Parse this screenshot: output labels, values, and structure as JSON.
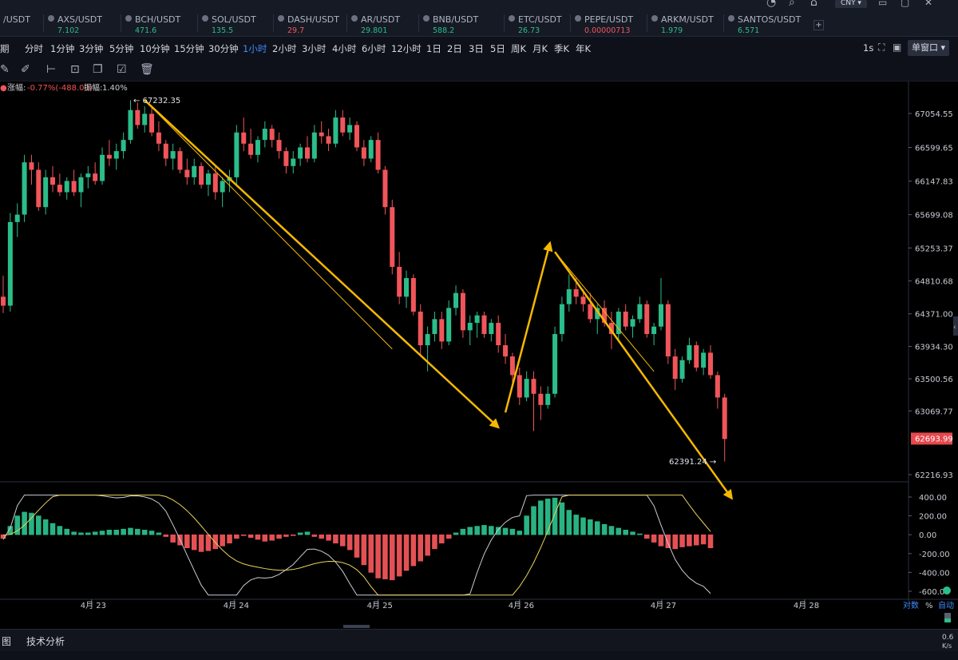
{
  "tickers": [
    {
      "symbol": "/USDT",
      "price": "",
      "dir": "up"
    },
    {
      "symbol": "AXS/USDT",
      "price": "7.102",
      "dir": "up"
    },
    {
      "symbol": "BCH/USDT",
      "price": "471.6",
      "dir": "up"
    },
    {
      "symbol": "SOL/USDT",
      "price": "135.5",
      "dir": "up"
    },
    {
      "symbol": "DASH/USDT",
      "price": "29.7",
      "dir": "dn"
    },
    {
      "symbol": "AR/USDT",
      "price": "29.801",
      "dir": "up"
    },
    {
      "symbol": "BNB/USDT",
      "price": "588.2",
      "dir": "up"
    },
    {
      "symbol": "ETC/USDT",
      "price": "26.73",
      "dir": "up"
    },
    {
      "symbol": "PEPE/USDT",
      "price": "0.00000713",
      "dir": "dn"
    },
    {
      "symbol": "ARKM/USDT",
      "price": "1.979",
      "dir": "up"
    },
    {
      "symbol": "SANTOS/USDT",
      "price": "6.571",
      "dir": "up"
    }
  ],
  "currency": "CNY",
  "add_symbol": "+",
  "intervals": [
    "期",
    "分时",
    "1分钟",
    "3分钟",
    "5分钟",
    "10分钟",
    "15分钟",
    "30分钟",
    "1小时",
    "2小时",
    "3小时",
    "4小时",
    "6小时",
    "12小时",
    "1日",
    "2日",
    "3日",
    "5日",
    "周K",
    "月K",
    "季K",
    "年K"
  ],
  "active_interval": "1小时",
  "refresh_rate": "1s",
  "window_mode": "单窗口",
  "change_label": "涨幅:",
  "change_value": "-0.77%(-488.00)",
  "amplitude_label": "振幅:",
  "amplitude_value": "1.40%",
  "high_label": "67232.35",
  "low_label": "62391.24",
  "last_price": "62693.99",
  "scale_log": "对数",
  "scale_pct": "%",
  "scale_auto": "自动",
  "speed_value": "0.6",
  "speed_unit": "K/s",
  "bottom_tabs": [
    "图",
    "技术分析"
  ],
  "chart_data": {
    "type": "candlestick",
    "price_axis_ticks": [
      67054.55,
      66599.65,
      66147.83,
      65699.08,
      65253.37,
      64810.68,
      64371.0,
      63934.3,
      63500.56,
      63069.77,
      62216.93
    ],
    "price_axis_labels": [
      "67054.55",
      "66599.65",
      "66147.83",
      "65699.08",
      "65253.37",
      "64810.68",
      "64371.00",
      "63934.30",
      "63500.56",
      "63069.77",
      "62216.93"
    ],
    "macd_ticks": [
      400,
      200,
      0,
      -200,
      -400,
      -600
    ],
    "macd_labels": [
      "400.00",
      "200.00",
      "0.00",
      "-200.00",
      "-400.00",
      "-600.00"
    ],
    "date_labels": [
      "4月 23",
      "4月 24",
      "4月 25",
      "4月 26",
      "4月 27",
      "4月 28"
    ],
    "colors": {
      "up": "#2bbd8a",
      "down": "#f0555a",
      "arrow": "#f5b800",
      "dif": "#c8ccd4",
      "dea": "#e8d35a"
    },
    "candles": [
      [
        64600,
        64880,
        64380,
        64480
      ],
      [
        64480,
        65720,
        64400,
        65600
      ],
      [
        65600,
        65850,
        65400,
        65700
      ],
      [
        65700,
        66500,
        65600,
        66400
      ],
      [
        66400,
        66500,
        66100,
        66300
      ],
      [
        66300,
        66400,
        65750,
        65800
      ],
      [
        65800,
        66300,
        65700,
        66200
      ],
      [
        66200,
        66350,
        66000,
        66100
      ],
      [
        66100,
        66250,
        65950,
        66000
      ],
      [
        66000,
        66200,
        65900,
        66150
      ],
      [
        66150,
        66300,
        65950,
        66000
      ],
      [
        66000,
        66250,
        65800,
        66200
      ],
      [
        66200,
        66350,
        66050,
        66250
      ],
      [
        66250,
        66400,
        66100,
        66150
      ],
      [
        66150,
        66600,
        66100,
        66500
      ],
      [
        66500,
        66700,
        66350,
        66450
      ],
      [
        66450,
        66650,
        66300,
        66550
      ],
      [
        66550,
        66800,
        66450,
        66700
      ],
      [
        66700,
        67232.35,
        66650,
        67100
      ],
      [
        67100,
        67200,
        66850,
        66900
      ],
      [
        66900,
        67150,
        66800,
        67050
      ],
      [
        67050,
        67150,
        66750,
        66800
      ],
      [
        66800,
        66950,
        66550,
        66650
      ],
      [
        66650,
        66700,
        66350,
        66450
      ],
      [
        66450,
        66650,
        66300,
        66550
      ],
      [
        66550,
        66600,
        66250,
        66300
      ],
      [
        66300,
        66450,
        66100,
        66200
      ],
      [
        66200,
        66450,
        66100,
        66350
      ],
      [
        66350,
        66400,
        66050,
        66100
      ],
      [
        66100,
        66300,
        65950,
        66250
      ],
      [
        66250,
        66350,
        65900,
        66000
      ],
      [
        66000,
        66200,
        65800,
        66150
      ],
      [
        66150,
        66300,
        66000,
        66200
      ],
      [
        66200,
        66900,
        66100,
        66800
      ],
      [
        66800,
        67000,
        66550,
        66650
      ],
      [
        66650,
        66850,
        66450,
        66500
      ],
      [
        66500,
        66750,
        66400,
        66700
      ],
      [
        66700,
        66950,
        66600,
        66850
      ],
      [
        66850,
        66900,
        66600,
        66700
      ],
      [
        66700,
        66800,
        66450,
        66550
      ],
      [
        66550,
        66600,
        66250,
        66350
      ],
      [
        66350,
        66550,
        66250,
        66450
      ],
      [
        66450,
        66650,
        66350,
        66600
      ],
      [
        66600,
        66750,
        66400,
        66450
      ],
      [
        66450,
        66900,
        66400,
        66800
      ],
      [
        66800,
        66950,
        66650,
        66750
      ],
      [
        66750,
        66850,
        66550,
        66650
      ],
      [
        66650,
        67100,
        66600,
        67000
      ],
      [
        67000,
        67100,
        66750,
        66800
      ],
      [
        66800,
        67000,
        66700,
        66900
      ],
      [
        66900,
        66950,
        66550,
        66600
      ],
      [
        66600,
        66700,
        66350,
        66450
      ],
      [
        66450,
        66750,
        66400,
        66700
      ],
      [
        66700,
        66800,
        66250,
        66300
      ],
      [
        66300,
        66350,
        65700,
        65800
      ],
      [
        65800,
        65900,
        64900,
        65000
      ],
      [
        65000,
        65200,
        64500,
        64600
      ],
      [
        64600,
        64950,
        64450,
        64850
      ],
      [
        64850,
        64900,
        64350,
        64400
      ],
      [
        64400,
        64500,
        63800,
        63950
      ],
      [
        63950,
        64200,
        63600,
        64100
      ],
      [
        64100,
        64400,
        64000,
        64300
      ],
      [
        64300,
        64400,
        63900,
        64000
      ],
      [
        64000,
        64550,
        63950,
        64450
      ],
      [
        64450,
        64750,
        64350,
        64650
      ],
      [
        64650,
        64700,
        64050,
        64150
      ],
      [
        64150,
        64350,
        63950,
        64250
      ],
      [
        64250,
        64400,
        64050,
        64350
      ],
      [
        64350,
        64400,
        64050,
        64100
      ],
      [
        64100,
        64300,
        64000,
        64250
      ],
      [
        64250,
        64350,
        63850,
        63950
      ],
      [
        63950,
        64100,
        63700,
        63800
      ],
      [
        63800,
        63850,
        63450,
        63550
      ],
      [
        63550,
        63650,
        63150,
        63250
      ],
      [
        63250,
        63600,
        63200,
        63500
      ],
      [
        63500,
        63600,
        62800,
        63300
      ],
      [
        63300,
        63400,
        62950,
        63150
      ],
      [
        63150,
        63400,
        63100,
        63300
      ],
      [
        63300,
        64200,
        63250,
        64100
      ],
      [
        64100,
        64600,
        64000,
        64500
      ],
      [
        64500,
        64900,
        64400,
        64700
      ],
      [
        64700,
        64850,
        64500,
        64600
      ],
      [
        64600,
        64700,
        64400,
        64500
      ],
      [
        64500,
        64650,
        64250,
        64300
      ],
      [
        64300,
        64500,
        64100,
        64450
      ],
      [
        64450,
        64550,
        64200,
        64250
      ],
      [
        64250,
        64400,
        63900,
        64100
      ],
      [
        64100,
        64450,
        64000,
        64400
      ],
      [
        64400,
        64500,
        64150,
        64200
      ],
      [
        64200,
        64350,
        64050,
        64300
      ],
      [
        64300,
        64600,
        64250,
        64500
      ],
      [
        64500,
        64550,
        64050,
        64100
      ],
      [
        64100,
        64250,
        63950,
        64200
      ],
      [
        64200,
        64850,
        64150,
        64500
      ],
      [
        64500,
        64550,
        63700,
        63800
      ],
      [
        63800,
        63900,
        63350,
        63500
      ],
      [
        63500,
        63800,
        63450,
        63750
      ],
      [
        63750,
        64050,
        63700,
        63950
      ],
      [
        63950,
        64000,
        63600,
        63650
      ],
      [
        63650,
        63900,
        63550,
        63850
      ],
      [
        63850,
        63950,
        63500,
        63550
      ],
      [
        63550,
        63600,
        63100,
        63250
      ],
      [
        63250,
        63300,
        62391.24,
        62693.99
      ]
    ],
    "macd_histogram": [
      -40,
      90,
      200,
      240,
      230,
      200,
      160,
      120,
      90,
      60,
      30,
      20,
      20,
      30,
      40,
      50,
      50,
      60,
      70,
      60,
      50,
      40,
      20,
      -20,
      -80,
      -110,
      -140,
      -160,
      -180,
      -170,
      -150,
      -120,
      -90,
      -40,
      -10,
      -30,
      -50,
      -70,
      -60,
      -40,
      -20,
      -10,
      20,
      30,
      -20,
      -40,
      -60,
      -90,
      -120,
      -160,
      -240,
      -320,
      -400,
      -460,
      -470,
      -480,
      -440,
      -380,
      -330,
      -280,
      -220,
      -150,
      -90,
      -40,
      20,
      60,
      80,
      90,
      100,
      90,
      80,
      70,
      60,
      40,
      200,
      300,
      360,
      380,
      390,
      340,
      260,
      210,
      180,
      160,
      140,
      110,
      90,
      70,
      50,
      30,
      10,
      -40,
      -80,
      -120,
      -140,
      -150,
      -130,
      -120,
      -110,
      -100,
      -140
    ],
    "title": "",
    "xlabel": "",
    "ylabel": ""
  }
}
